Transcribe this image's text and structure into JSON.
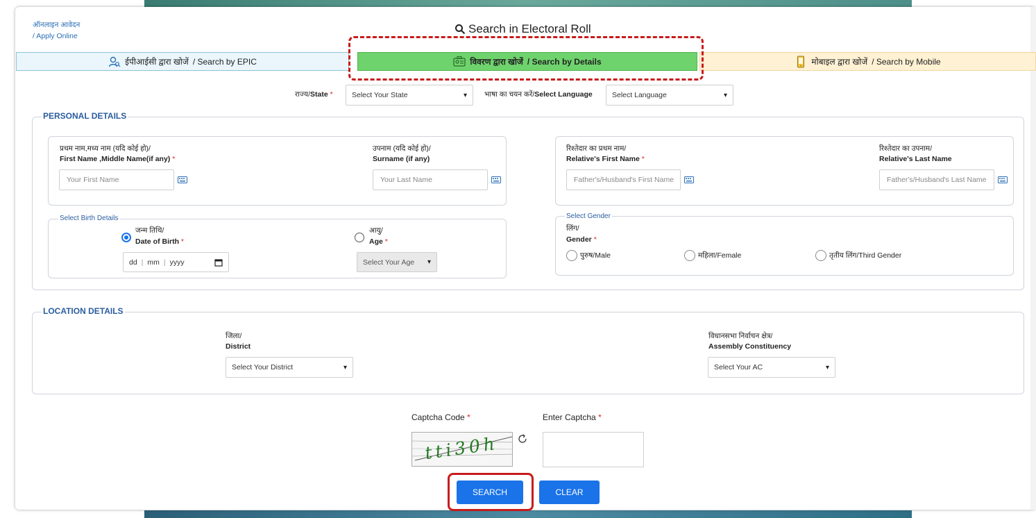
{
  "breadcrumb": {
    "line1": "ऑनलाइन आवेदन",
    "line2": "/ Apply Online"
  },
  "page_title": "Search in Electoral Roll",
  "tabs": [
    {
      "label_hi": "ईपीआईसी द्वारा खोजें",
      "label_en": " / Search by EPIC",
      "icon": "user-search-icon"
    },
    {
      "label_hi": "विवरण द्वारा खोजें",
      "label_en": "/ Search by Details",
      "icon": "id-card-icon",
      "active": true
    },
    {
      "label_hi": "मोबाइल द्वारा खोजें",
      "label_en": " / Search by Mobile",
      "icon": "mobile-icon"
    }
  ],
  "top_filters": {
    "state_label_hi": "राज्य/",
    "state_label_en": "State",
    "state_value": "Select Your State",
    "language_label_hi": "भाषा का चयन करें/",
    "language_label_en": "Select Language",
    "language_value": "Select Language"
  },
  "personal": {
    "legend": "PERSONAL DETAILS",
    "first_name_hi": "प्रथम नाम,मध्य नाम (यदि कोई हो)/",
    "first_name_en": "First Name ,Middle Name(if any)",
    "first_name_placeholder": "Your First Name",
    "surname_hi": "उपनाम (यदि कोई हो)/",
    "surname_en": "Surname (if any)",
    "surname_placeholder": "Your Last Name",
    "relative_first_hi": "रिश्तेदार का प्रथम नाम/",
    "relative_first_en": "Relative's First Name",
    "relative_first_placeholder": "Father's/Husband's First Name",
    "relative_last_hi": "रिश्तेदार का उपनाम/",
    "relative_last_en": "Relative's Last Name",
    "relative_last_placeholder": "Father's/Husband's Last Name",
    "birth_legend": "Select Birth Details",
    "dob_hi": "जन्म तिथि/",
    "dob_en": "Date of Birth",
    "dob_dd": "dd",
    "dob_mm": "mm",
    "dob_yyyy": "yyyy",
    "age_hi": "आयु/",
    "age_en": "Age",
    "age_value": "Select Your Age",
    "gender_legend": "Select Gender",
    "gender_hi": "लिंग/",
    "gender_en": "Gender",
    "gender_male": "पुरुष/Male",
    "gender_female": "महिला/Female",
    "gender_third": "तृतीय लिंग/Third Gender"
  },
  "location": {
    "legend": "LOCATION DETAILS",
    "district_hi": "जिला/",
    "district_en": "District",
    "district_value": "Select Your District",
    "ac_hi": "विधानसभा निर्वाचन क्षेत्र/",
    "ac_en": "Assembly Constituency",
    "ac_value": "Select Your AC"
  },
  "captcha": {
    "code_label": "Captcha Code",
    "enter_label": "Enter Captcha",
    "text": "tti30h"
  },
  "buttons": {
    "search": "SEARCH",
    "clear": "CLEAR"
  },
  "colors": {
    "primary": "#1a73e8",
    "active_tab": "#6fd36d",
    "legend": "#2a5d9f",
    "highlight": "#c81b1b"
  }
}
